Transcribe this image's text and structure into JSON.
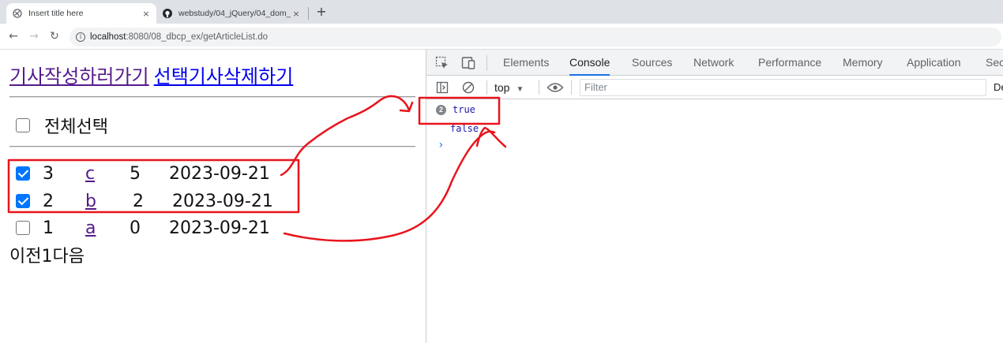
{
  "browser": {
    "tabs": [
      {
        "title": "Insert title here",
        "close": "×"
      },
      {
        "title": "webstudy/04_jQuery/04_dom_",
        "close": "×"
      }
    ],
    "newtab": "+",
    "url_host": "localhost",
    "url_path": ":8080/08_dbcp_ex/getArticleList.do"
  },
  "page": {
    "write_link": "기사작성하러가기",
    "delete_link": "선택기사삭제하기",
    "select_all_label": "전체선택",
    "rows": [
      {
        "no": "3",
        "title": "c",
        "hit": "5",
        "date": "2023-09-21",
        "checked": true
      },
      {
        "no": "2",
        "title": "b",
        "hit": "2",
        "date": "2023-09-21",
        "checked": true
      },
      {
        "no": "1",
        "title": "a",
        "hit": "0",
        "date": "2023-09-21",
        "checked": false
      }
    ],
    "pager": "이전1다음"
  },
  "devtools": {
    "tabs": [
      "Elements",
      "Console",
      "Sources",
      "Network",
      "Performance",
      "Memory",
      "Application",
      "Sec"
    ],
    "active_tab": "Console",
    "context": "top",
    "filter_placeholder": "Filter",
    "levels_label": "De",
    "logs": [
      {
        "count": "2",
        "value": "true"
      },
      {
        "count": "",
        "value": "false"
      }
    ],
    "prompt": "›"
  },
  "annotation_color": "#e8141c"
}
